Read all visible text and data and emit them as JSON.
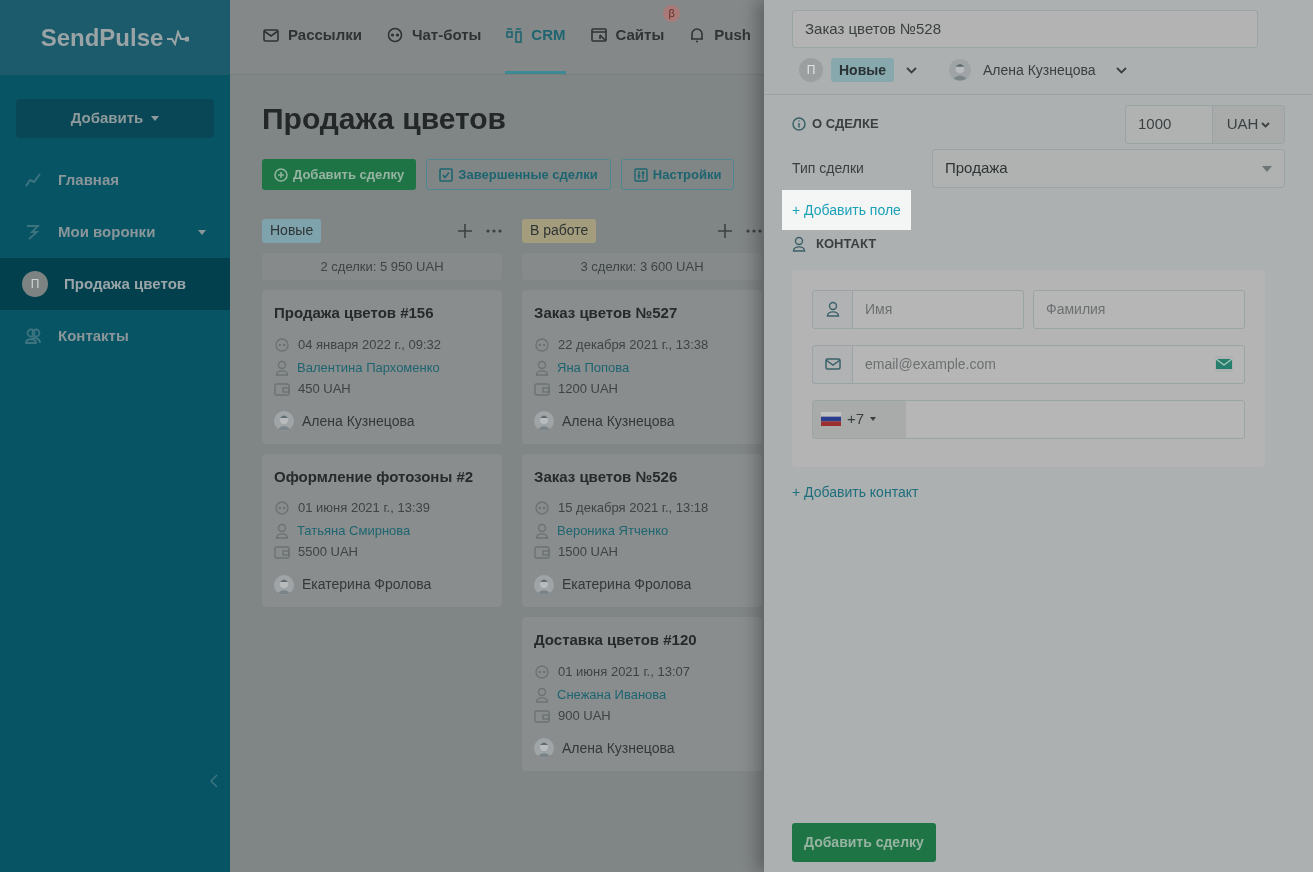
{
  "logo": "SendPulse",
  "sidebar": {
    "add_button": "Добавить",
    "items": [
      {
        "kind": "chart",
        "label": "Главная",
        "selected": false
      },
      {
        "kind": "funnel",
        "label": "Мои воронки",
        "selected": false,
        "expandable": true
      },
      {
        "kind": "avatar",
        "avatar_letter": "П",
        "label": "Продажа цветов",
        "selected": true
      },
      {
        "kind": "contacts",
        "label": "Контакты",
        "selected": false
      }
    ]
  },
  "nav": [
    {
      "kind": "mail",
      "label": "Рассылки",
      "selected": false
    },
    {
      "kind": "chat",
      "label": "Чат-боты",
      "selected": false
    },
    {
      "kind": "crm",
      "label": "CRM",
      "selected": true
    },
    {
      "kind": "site",
      "label": "Сайты",
      "selected": false,
      "badge": "β"
    },
    {
      "kind": "bell",
      "label": "Push",
      "selected": false
    }
  ],
  "page_title": "Продажа цветов",
  "toolbar": [
    {
      "kind": "primary",
      "label": "Добавить сделку"
    },
    {
      "kind": "check",
      "label": "Завершенные сделки"
    },
    {
      "kind": "settings",
      "label": "Настройки"
    }
  ],
  "columns": [
    {
      "name": "Новые",
      "color": "#7fa3ad",
      "summary": "2 сделки: 5 950 UAH",
      "deals": [
        {
          "title": "Продажа цветов #156",
          "date": "04 января 2022 г., 09:32",
          "contact": "Валентина Пархоменко",
          "amount": "450 UAH",
          "owner": "Алена Кузнецова"
        },
        {
          "title": "Оформление фотозоны #2",
          "date": "01 июня 2021 г., 13:39",
          "contact": "Татьяна Смирнова",
          "amount": "5500 UAH",
          "owner": "Екатерина Фролова"
        }
      ]
    },
    {
      "name": "В работе",
      "color": "#a39d7e",
      "summary": "3 сделки: 3 600 UAH",
      "deals": [
        {
          "title": "Заказ цветов №527",
          "date": "22 декабря 2021 г., 13:38",
          "contact": "Яна Попова",
          "amount": "1200 UAH",
          "owner": "Алена Кузнецова"
        },
        {
          "title": "Заказ цветов №526",
          "date": "15 декабря 2021 г., 13:18",
          "contact": "Вероника Ятченко",
          "amount": "1500 UAH",
          "owner": "Екатерина Фролова"
        },
        {
          "title": "Доставка цветов #120",
          "date": "01 июня 2021 г., 13:07",
          "contact": "Снежана Иванова",
          "amount": "900 UAH",
          "owner": "Алена Кузнецова"
        }
      ]
    }
  ],
  "panel": {
    "title_value": "Заказ цветов №528",
    "pipeline_letter": "П",
    "stage": "Новые",
    "owner": "Алена Кузнецова",
    "deal_section": "О СДЕЛКЕ",
    "amount": "1000",
    "currency": "UAH",
    "type_label": "Тип сделки",
    "type_value": "Продажа",
    "add_field": "+ Добавить поле",
    "contact_section": "КОНТАКТ",
    "first_name": {
      "placeholder": "Имя"
    },
    "last_name": {
      "placeholder": "Фамилия"
    },
    "email": {
      "placeholder": "email@example.com"
    },
    "phone_code": "+7",
    "add_contact": "+ Добавить контакт",
    "submit": "Добавить сделку"
  }
}
